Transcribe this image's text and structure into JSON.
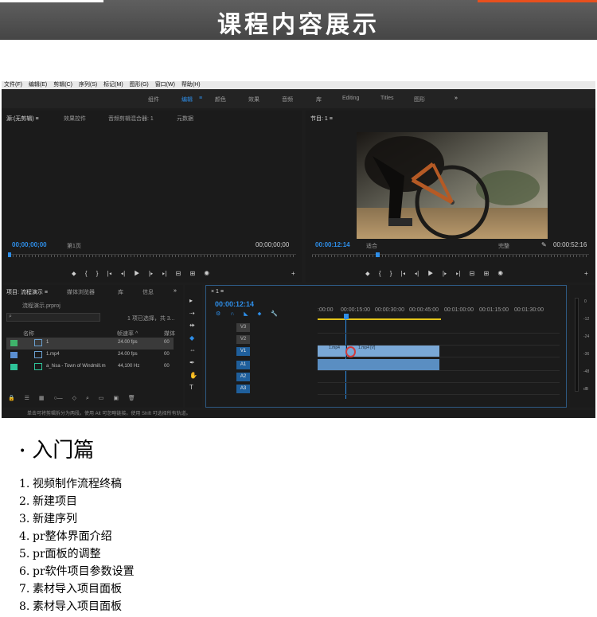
{
  "banner": {
    "title": "课程内容展示"
  },
  "premiere": {
    "menu": [
      "文件(F)",
      "编辑(E)",
      "剪辑(C)",
      "序列(S)",
      "标记(M)",
      "图形(G)",
      "窗口(W)",
      "帮助(H)"
    ],
    "workspaces": [
      "组件",
      "编辑",
      "颜色",
      "效果",
      "音频",
      "库",
      "Editing",
      "Titles",
      "图形",
      "»"
    ],
    "active_workspace": "编辑",
    "source_panel": {
      "tabs": [
        "源:(无剪辑) ≡",
        "效果控件",
        "音频剪辑混合器: 1",
        "元数据"
      ],
      "timecode_left": "00;00;00;00",
      "page": "第1页",
      "timecode_right": "00;00;00;00"
    },
    "program_panel": {
      "tab": "节目: 1 ≡",
      "timecode": "00:00:12:14",
      "fit": "适合",
      "quality": "完整",
      "duration": "00:00:52:16"
    },
    "project_panel": {
      "tabs": [
        "项目: 流程演示 ≡",
        "媒体浏览器",
        "库",
        "信息",
        "»"
      ],
      "file": "流程演示.prproj",
      "selection": "1 项已选择，共 3...",
      "col_name": "名称",
      "col_fps": "帧速率 ^",
      "col_media": "媒体",
      "rows": [
        {
          "name": "1",
          "fps": "24.00 fps",
          "media": "00",
          "color": "#3fb36b"
        },
        {
          "name": "1.mp4",
          "fps": "24.00 fps",
          "media": "00",
          "color": "#5b8fd1"
        },
        {
          "name": "a_hisa - Town of Windmill.m",
          "fps": "44,100 Hz",
          "media": "00",
          "color": "#2ec499"
        }
      ]
    },
    "timeline": {
      "tab": "× 1 ≡",
      "timecode": "00:00:12:14",
      "ruler": [
        ":00:00",
        "00:00:15:00",
        "00:00:30:00",
        "00:00:45:00",
        "00:01:00:00",
        "00:01:15:00",
        "00:01:30:00"
      ],
      "tracks": [
        "V3",
        "V2",
        "V1",
        "A1",
        "A2",
        "A3"
      ],
      "clip_labels": [
        "1.mp4",
        "1.mp4 [V]"
      ],
      "meter_ticks": [
        "0",
        "-12",
        "-24",
        "-36",
        "-48",
        "dB"
      ]
    },
    "status": "单击可将剪辑拆分为两段。使用 Alt 可忽略链接。使用 Shift 可选择所有轨道。"
  },
  "section": {
    "title": "入门篇"
  },
  "lessons": [
    {
      "num": "1.",
      "text": "视频制作流程终稿"
    },
    {
      "num": "2.",
      "text": "新建项目"
    },
    {
      "num": "3.",
      "text": "新建序列"
    },
    {
      "num": "4.",
      "text": "pr整体界面介绍"
    },
    {
      "num": "5.",
      "text": "pr面板的调整"
    },
    {
      "num": "6.",
      "text": "pr软件项目参数设置"
    },
    {
      "num": "7.",
      "text": "素材导入项目面板"
    },
    {
      "num": "8.",
      "text": "素材导入项目面板"
    }
  ]
}
